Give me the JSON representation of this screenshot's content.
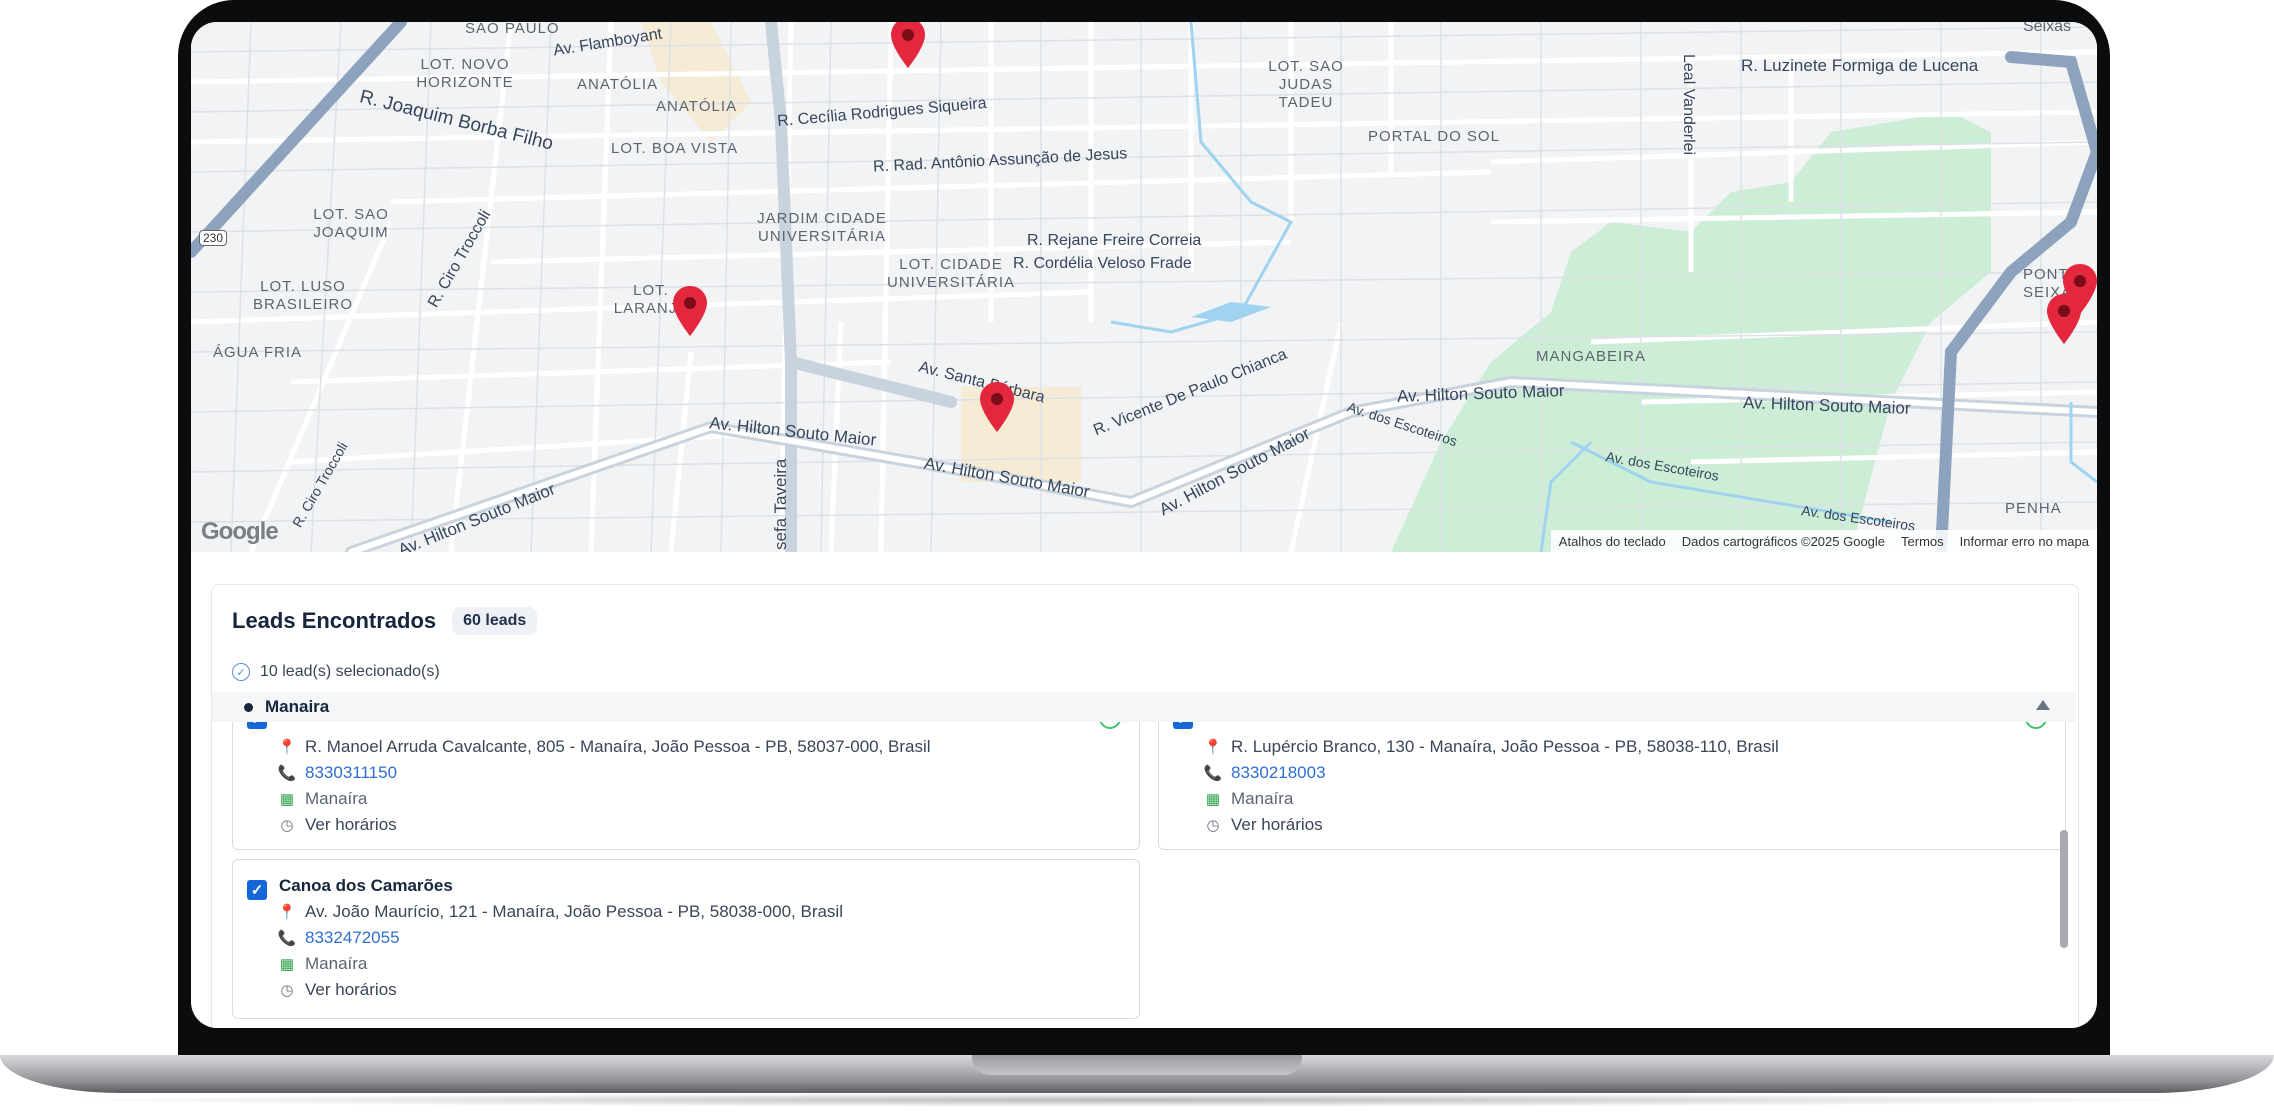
{
  "map": {
    "neighborhoods": [
      "SÃO PAULO",
      "LOT. NOVO HORIZONTE",
      "ANATÓLIA",
      "ANATÓLIA",
      "LOT. SAO JUDAS TADEU",
      "LOT. BOA VISTA",
      "PORTAL DO SOL",
      "LOT. SAO JOAQUIM",
      "JARDIM CIDADE UNIVERSITÁRIA",
      "LOT. CIDADE UNIVERSITÁRIA",
      "LOT. LUSO BRASILEIRO",
      "LOT. LARANJE",
      "ÁGUA FRIA",
      "MANGABEIRA",
      "PONTA SEIXA",
      "PENHA",
      "Seixas"
    ],
    "streets": [
      "Av. Flamboyant",
      "R. Joaquim Borba Filho",
      "R. Cecília Rodrigues Siqueira",
      "R. Luzinete Formiga de Lucena",
      "R. Rad. Antônio Assunção de Jesus",
      "Leal Vanderlei",
      "R. Rejane Freire Correia",
      "R. Cordélia Veloso Frade",
      "R. Ciro Troccoli",
      "Av. Santa Bárbara",
      "R. Vicente De Paulo Chianca",
      "Av. Hilton Souto Maior",
      "Av. Hilton Souto Maior",
      "Av. Hilton Souto Maior",
      "Av. Hilton Souto Maior",
      "Av. Hilton Souto Maior",
      "Av. Hilton Souto Maior",
      "Av. dos Escoteiros",
      "Av. dos Escoteiros",
      "Av. dos Escoteiros",
      "R. Ciro Troccoli",
      "sefa Taveira",
      "230"
    ],
    "google_logo": "Google",
    "attribution": [
      "Atalhos do teclado",
      "Dados cartográficos ©2025 Google",
      "Termos",
      "Informar erro no mapa"
    ]
  },
  "leads": {
    "title": "Leads Encontrados",
    "count_badge": "60 leads",
    "selected_text": "10 lead(s) selecionado(s)",
    "group_name": "Manaira",
    "cards": [
      {
        "name": "",
        "address": "R. Manoel Arruda Cavalcante, 805 - Manaíra, João Pessoa - PB, 58037-000, Brasil",
        "phone": "8330311150",
        "neighborhood": "Manaíra",
        "hours": "Ver horários",
        "checked": true
      },
      {
        "name": "",
        "address": "R. Lupércio Branco, 130 - Manaíra, João Pessoa - PB, 58038-110, Brasil",
        "phone": "8330218003",
        "neighborhood": "Manaíra",
        "hours": "Ver horários",
        "checked": true
      },
      {
        "name": "Canoa dos Camarões",
        "address": "Av. João Maurício, 121 - Manaíra, João Pessoa - PB, 58038-000, Brasil",
        "phone": "8332472055",
        "neighborhood": "Manaíra",
        "hours": "Ver horários",
        "checked": true
      }
    ]
  },
  "colors": {
    "pin": "#e3273d",
    "accent": "#1467d6",
    "title": "#16263d",
    "park": "#cdeed6"
  },
  "icons": [
    "map-pin-icon",
    "location-icon",
    "phone-icon",
    "store-icon",
    "clock-icon",
    "check-circle-icon",
    "chevron-up-icon",
    "checkbox-checked-icon",
    "verified-ring-icon"
  ]
}
